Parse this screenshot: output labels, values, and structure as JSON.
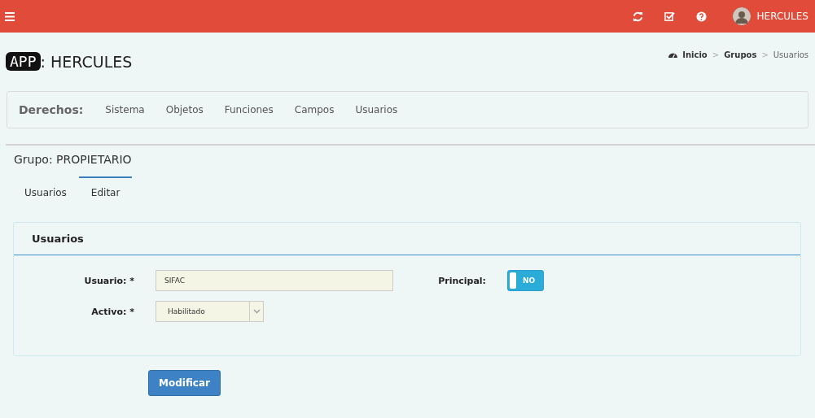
{
  "topbar": {
    "user": "HERCULES"
  },
  "brand": {
    "logo": "APP",
    "title": ": HERCULES"
  },
  "breadcrumb": [
    {
      "label": "Inicio"
    },
    {
      "separator": ">",
      "label": "Grupos"
    },
    {
      "separator": ">",
      "label": "Usuarios"
    }
  ],
  "rights_nav": {
    "label": "Derechos:",
    "items": [
      "Sistema",
      "Objetos",
      "Funciones",
      "Campos",
      "Usuarios"
    ]
  },
  "group_title": "Grupo: PROPIETARIO",
  "tabs": [
    {
      "label": "Usuarios",
      "selected": false
    },
    {
      "label": "Editar",
      "selected": true
    }
  ],
  "panel": {
    "title": "Usuarios",
    "usuario": {
      "label": "Usuario: *",
      "value": "SIFAC"
    },
    "activo": {
      "label": "Activo: *",
      "value": "Habilitado"
    },
    "principal": {
      "label": "Principal:",
      "on": false,
      "text": "NO"
    }
  },
  "submit": "Modificar"
}
